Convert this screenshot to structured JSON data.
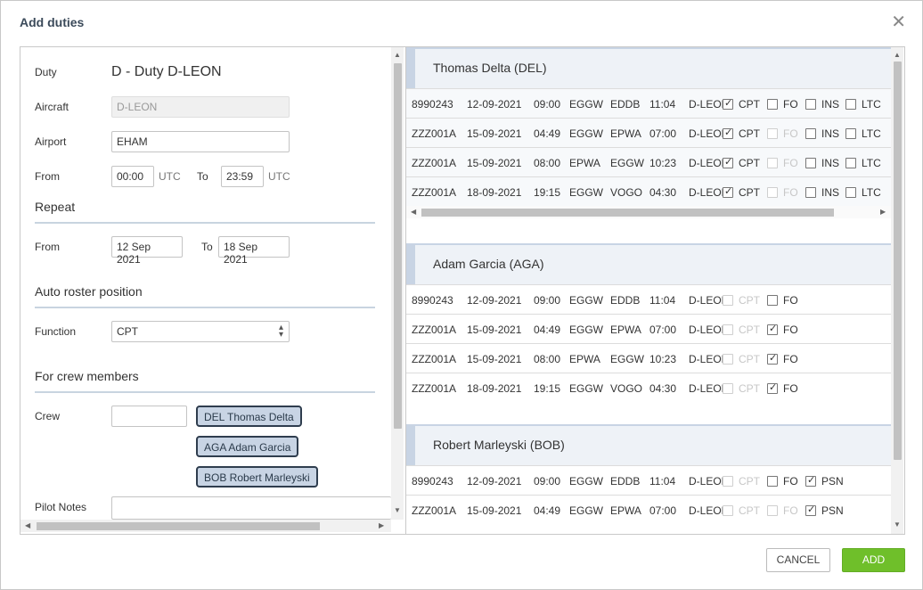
{
  "dialog": {
    "title": "Add duties",
    "cancel_label": "CANCEL",
    "add_label": "ADD"
  },
  "form": {
    "duty_label": "Duty",
    "duty_value": "D - Duty D-LEON",
    "aircraft_label": "Aircraft",
    "aircraft_value": "D-LEON",
    "airport_label": "Airport",
    "airport_value": "EHAM",
    "from_label": "From",
    "from_value": "00:00",
    "from_tz": "UTC",
    "to_label": "To",
    "to_value": "23:59",
    "to_tz": "UTC",
    "repeat_heading": "Repeat",
    "repeat_from_label": "From",
    "repeat_from_value": "12 Sep 2021",
    "repeat_to_label": "To",
    "repeat_to_value": "18 Sep 2021",
    "roster_heading": "Auto roster position",
    "function_label": "Function",
    "function_value": "CPT",
    "crew_heading": "For crew members",
    "crew_label": "Crew",
    "crew_chips": [
      "DEL Thomas Delta",
      "AGA Adam Garcia",
      "BOB Robert Marleyski"
    ],
    "pilot_notes_label": "Pilot Notes"
  },
  "groups": [
    {
      "name": "Thomas Delta (DEL)",
      "rows": [
        [
          "8990243",
          "12-09-2021",
          "09:00",
          "EGGW",
          "EDDB",
          "11:04",
          "D-LEON"
        ],
        [
          "ZZZ001A",
          "15-09-2021",
          "04:49",
          "EGGW",
          "EPWA",
          "07:00",
          "D-LEON"
        ],
        [
          "ZZZ001A",
          "15-09-2021",
          "08:00",
          "EPWA",
          "EGGW",
          "10:23",
          "D-LEON"
        ],
        [
          "ZZZ001A",
          "18-09-2021",
          "19:15",
          "EGGW",
          "VOGO",
          "04:30",
          "D-LEON"
        ]
      ],
      "labels": [
        "CPT",
        "FO",
        "INS",
        "LTC"
      ]
    },
    {
      "name": "Adam Garcia (AGA)",
      "rows": [
        [
          "8990243",
          "12-09-2021",
          "09:00",
          "EGGW",
          "EDDB",
          "11:04",
          "D-LEON"
        ],
        [
          "ZZZ001A",
          "15-09-2021",
          "04:49",
          "EGGW",
          "EPWA",
          "07:00",
          "D-LEON"
        ],
        [
          "ZZZ001A",
          "15-09-2021",
          "08:00",
          "EPWA",
          "EGGW",
          "10:23",
          "D-LEON"
        ],
        [
          "ZZZ001A",
          "18-09-2021",
          "19:15",
          "EGGW",
          "VOGO",
          "04:30",
          "D-LEON"
        ]
      ],
      "labels": [
        "CPT",
        "FO"
      ]
    },
    {
      "name": "Robert Marleyski (BOB)",
      "rows": [
        [
          "8990243",
          "12-09-2021",
          "09:00",
          "EGGW",
          "EDDB",
          "11:04",
          "D-LEON"
        ],
        [
          "ZZZ001A",
          "15-09-2021",
          "04:49",
          "EGGW",
          "EPWA",
          "07:00",
          "D-LEON"
        ]
      ],
      "labels": [
        "CPT",
        "FO",
        "PSN"
      ]
    }
  ],
  "colors": {
    "accent_green": "#6fbf2a",
    "chip_bg": "#c8d4e4",
    "chip_border": "#2f3d4e"
  }
}
